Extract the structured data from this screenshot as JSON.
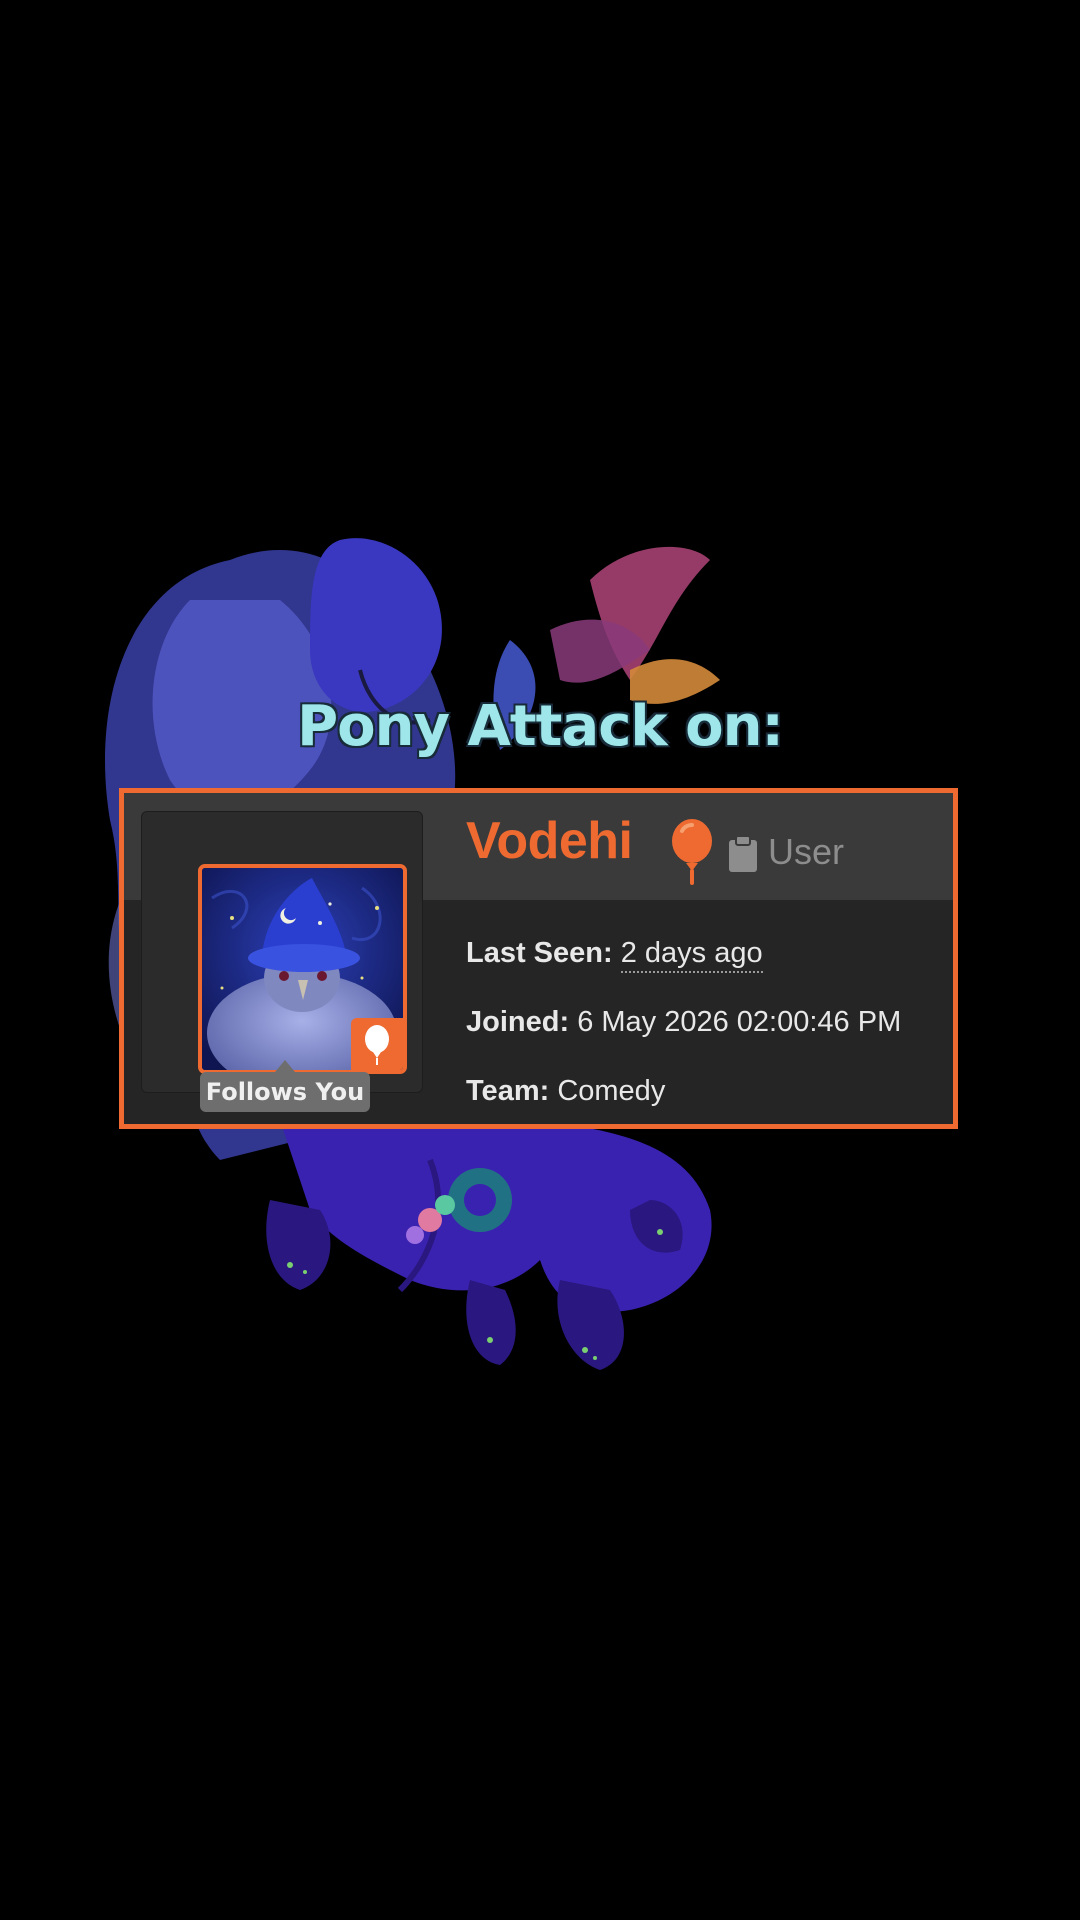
{
  "overlay": {
    "title": "Pony Attack on:"
  },
  "profile": {
    "username": "Vodehi",
    "role": "User",
    "follows_badge": "Follows You",
    "fields": [
      {
        "label": "Last Seen:",
        "value": "2 days ago"
      },
      {
        "label": "Joined:",
        "value": "6 May 2026 02:00:46 PM"
      },
      {
        "label": "Team:",
        "value": "Comedy"
      }
    ]
  },
  "icons": {
    "team_icon": "balloon-icon",
    "role_icon": "clipboard-icon",
    "avatar_badge_icon": "balloon-icon"
  },
  "colors": {
    "accent": "#ee6a31",
    "title_text": "#9ee6ea",
    "card_bg": "#252525",
    "header_bg": "#3a3a3a",
    "muted_text": "#8d8d8d"
  }
}
